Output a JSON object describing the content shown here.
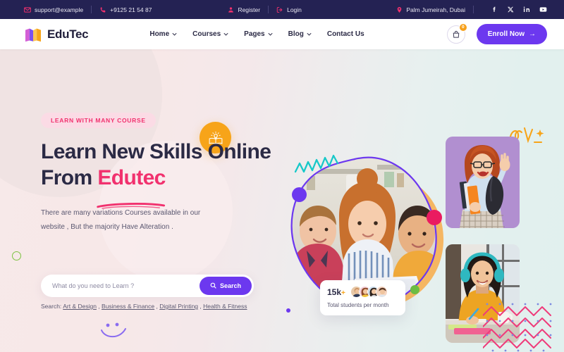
{
  "topbar": {
    "email": "support@example",
    "email_icon": "envelope-icon",
    "phone": "+9125 21 54 87",
    "phone_icon": "phone-icon",
    "register_label": "Register",
    "register_icon": "user-icon",
    "login_label": "Login",
    "login_icon": "login-arrow-icon",
    "location": "Palm Jumeirah, Dubai",
    "location_icon": "map-pin-icon",
    "socials": [
      {
        "name": "facebook-icon",
        "label": "f"
      },
      {
        "name": "x-icon",
        "label": "X"
      },
      {
        "name": "linkedin-icon",
        "label": "in"
      },
      {
        "name": "youtube-icon",
        "label": "yt"
      }
    ],
    "bg_color": "#242253",
    "accent_color": "#f1316e"
  },
  "navbar": {
    "brand": "EduTec",
    "brand_icon": "open-book-logo-icon",
    "links": [
      {
        "label": "Home",
        "has_dropdown": true
      },
      {
        "label": "Courses",
        "has_dropdown": true
      },
      {
        "label": "Pages",
        "has_dropdown": true
      },
      {
        "label": "Blog",
        "has_dropdown": true
      },
      {
        "label": "Contact Us",
        "has_dropdown": false
      }
    ],
    "cart_icon": "shopping-bag-icon",
    "cart_count": "0",
    "cart_badge_color": "#f6a01a",
    "enroll_label": "Enroll Now",
    "enroll_arrow": "→",
    "enroll_color": "#6c38ef"
  },
  "hero": {
    "tag": "LEARN WITH MANY COURSE",
    "title_line1": "Learn New Skills Online",
    "title_line2_prefix": "From ",
    "title_highlight": "Edutec",
    "description": "There are many variations Courses available in our website , But the majority Have Alteration .",
    "badge_icon": "book-lightbulb-icon",
    "search_placeholder": "What do you need to Learn ?",
    "search_button": "Search",
    "search_icon": "search-icon",
    "search_links_label": "Search:",
    "search_links": [
      "Art & Design",
      "Business & Finance",
      "Digital Printing",
      "Health & Fitness"
    ],
    "highlight_color": "#f1316e",
    "heading_color": "#2b2a45"
  },
  "stats_card": {
    "value": "15k",
    "plus": "+",
    "label": "Total students per month",
    "avatar_count": 4
  },
  "decorations": [
    {
      "name": "teal-zigzag-decoration"
    },
    {
      "name": "purple-dot-decoration"
    },
    {
      "name": "pink-dot-decoration"
    },
    {
      "name": "green-dot-decoration"
    },
    {
      "name": "green-ring-decoration"
    },
    {
      "name": "purple-smiley-decoration"
    },
    {
      "name": "orange-burst-decoration"
    },
    {
      "name": "pink-zigzag-pattern-decoration"
    }
  ],
  "media": {
    "hero_blob_photo": "three-students-with-laptop-photo",
    "right_top_photo": "student-waving-with-books-photo",
    "right_bottom_photo": "student-with-headphones-photo"
  }
}
